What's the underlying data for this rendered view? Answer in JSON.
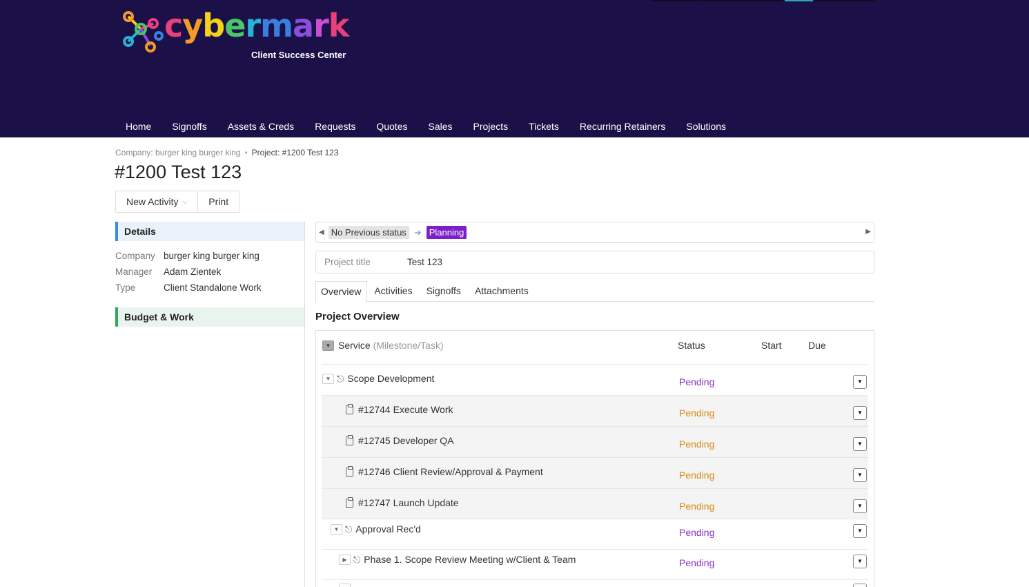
{
  "brand": {
    "logo_letters": [
      "c",
      "y",
      "b",
      "e",
      "r",
      "m",
      "a",
      "r",
      "k"
    ],
    "logo_colors": [
      "#e8407a",
      "#f39c23",
      "#f4d21b",
      "#4cc46a",
      "#26b3d6",
      "#3a7fe0",
      "#8a4fd9",
      "#c94fd0",
      "#e8407a"
    ],
    "subtitle": "Client Success Center",
    "header_bg": "#1b1148"
  },
  "nav": {
    "items": [
      "Home",
      "Signoffs",
      "Assets & Creds",
      "Requests",
      "Quotes",
      "Sales",
      "Projects",
      "Tickets",
      "Recurring Retainers",
      "Solutions"
    ]
  },
  "breadcrumb": {
    "company": "Company: burger king burger king",
    "separator": "•",
    "project": "Project: #1200 Test 123"
  },
  "page": {
    "title": "#1200 Test 123",
    "new_activity": "New Activity",
    "print": "Print"
  },
  "details": {
    "heading": "Details",
    "company_label": "Company",
    "company_value": "burger king burger king",
    "manager_label": "Manager",
    "manager_value": "Adam Zientek",
    "type_label": "Type",
    "type_value": "Client Standalone Work",
    "budget_heading": "Budget & Work"
  },
  "status": {
    "previous": "No Previous status",
    "current": "Planning",
    "current_color": "#7b20c9"
  },
  "project_title": {
    "label": "Project title",
    "value": "Test 123"
  },
  "tabs": [
    "Overview",
    "Activities",
    "Signoffs",
    "Attachments"
  ],
  "overview": {
    "heading": "Project Overview",
    "col_service": "Service",
    "col_service_hint": "(Milestone/Task)",
    "col_status": "Status",
    "col_start": "Start",
    "col_due": "Due",
    "rows": [
      {
        "name": "Scope Development",
        "status": "Pending",
        "kind": "milestone"
      },
      {
        "name": "#12744 Execute Work",
        "status": "Pending",
        "kind": "task"
      },
      {
        "name": "#12745 Developer QA",
        "status": "Pending",
        "kind": "task"
      },
      {
        "name": "#12746 Client Review/Approval & Payment",
        "status": "Pending",
        "kind": "task"
      },
      {
        "name": "#12747 Launch Update",
        "status": "Pending",
        "kind": "task"
      },
      {
        "name": "Approval Rec'd",
        "status": "Pending",
        "kind": "milestone"
      },
      {
        "name": "Phase 1. Scope Review Meeting w/Client & Team",
        "status": "Pending",
        "kind": "milestone"
      }
    ]
  }
}
